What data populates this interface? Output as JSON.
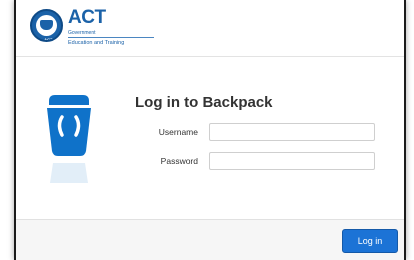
{
  "header": {
    "logo": {
      "title": "ACT",
      "subtitle": "Government",
      "department": "Education and Training",
      "crest_text": "ACT"
    }
  },
  "login": {
    "title": "Log in to Backpack",
    "username_label": "Username",
    "username_value": "",
    "password_label": "Password",
    "password_value": ""
  },
  "footer": {
    "login_button": "Log in"
  },
  "colors": {
    "brand": "#1b62a8",
    "button": "#1c73d6",
    "icon": "#0f72c9"
  },
  "icons": [
    "act-crest-icon",
    "backpack-icon"
  ]
}
